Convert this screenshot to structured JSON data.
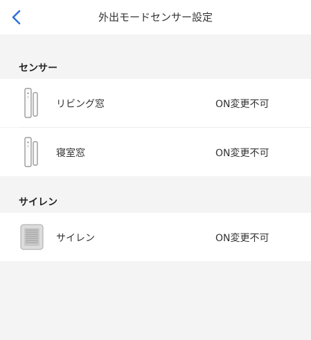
{
  "header": {
    "title": "外出モードセンサー設定",
    "back_icon": "chevron-left-icon",
    "accent_color": "#2e6fd8"
  },
  "sections": [
    {
      "title": "センサー",
      "items": [
        {
          "label": "リビング窓",
          "status": "ON変更不可",
          "icon": "door-window-sensor-icon"
        },
        {
          "label": "寝室窓",
          "status": "ON変更不可",
          "icon": "door-window-sensor-icon"
        }
      ]
    },
    {
      "title": "サイレン",
      "items": [
        {
          "label": "サイレン",
          "status": "ON変更不可",
          "icon": "siren-device-icon"
        }
      ]
    }
  ]
}
